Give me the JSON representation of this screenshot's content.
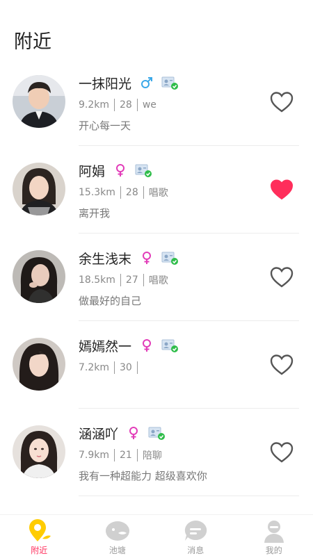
{
  "header": {
    "title": "附近"
  },
  "users": [
    {
      "name": "一抹阳光",
      "gender": "male",
      "distance": "9.2km",
      "age": "28",
      "tag": "we",
      "bio": "开心每一天",
      "liked": false
    },
    {
      "name": "阿娟",
      "gender": "female",
      "distance": "15.3km",
      "age": "28",
      "tag": "唱歌",
      "bio": "离开我",
      "liked": true
    },
    {
      "name": "余生浅末",
      "gender": "female",
      "distance": "18.5km",
      "age": "27",
      "tag": "唱歌",
      "bio": "做最好的自己",
      "liked": false
    },
    {
      "name": "嫣嫣然一",
      "gender": "female",
      "distance": "7.2km",
      "age": "30",
      "tag": "",
      "bio": "",
      "liked": false
    },
    {
      "name": "涵涵吖",
      "gender": "female",
      "distance": "7.9km",
      "age": "21",
      "tag": "陪聊",
      "bio": "我有一种超能力 超级喜欢你",
      "liked": false
    }
  ],
  "tabs": [
    {
      "label": "附近",
      "icon": "location-pin-icon",
      "active": true
    },
    {
      "label": "池塘",
      "icon": "fish-icon",
      "active": false
    },
    {
      "label": "消息",
      "icon": "chat-bubble-icon",
      "active": false
    },
    {
      "label": "我的",
      "icon": "user-icon",
      "active": false
    }
  ],
  "colors": {
    "male": "#3aa8e8",
    "female": "#e23cb9",
    "like_active": "#ff2e5b",
    "like_inactive": "#555555",
    "tab_active": "#ff2e5b",
    "tab_active_icon": "#ffcc00",
    "tab_inactive_icon": "#d0d0d0",
    "verified": "#2fbd4a"
  }
}
